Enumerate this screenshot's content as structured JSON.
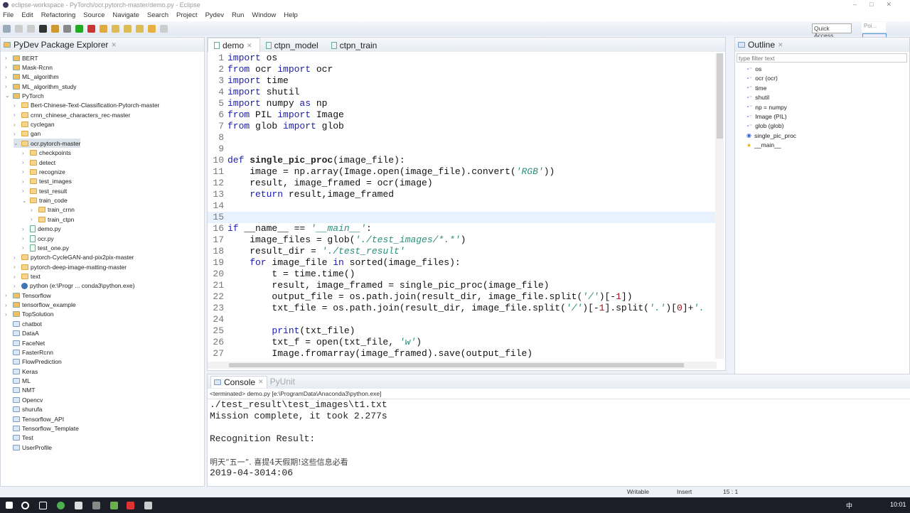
{
  "window": {
    "title": "eclipse-workspace - PyTorch/ocr.pytorch-master/demo.py - Eclipse"
  },
  "menu": [
    "File",
    "Edit",
    "Refactoring",
    "Source",
    "Navigate",
    "Search",
    "Project",
    "Pydev",
    "Run",
    "Window",
    "Help"
  ],
  "toolbar": {
    "quick_access": "Quick Access",
    "perspective": "Poi...",
    "start_label": "Start"
  },
  "explorer": {
    "title": "PyDev Package Explorer",
    "items": [
      {
        "label": "BERT",
        "depth": 0,
        "icon": "project",
        "tw": ">"
      },
      {
        "label": "Mask-Rcnn",
        "depth": 0,
        "icon": "project",
        "tw": ">"
      },
      {
        "label": "ML_algorithm",
        "depth": 0,
        "icon": "project",
        "tw": ">"
      },
      {
        "label": "ML_algorithm_study",
        "depth": 0,
        "icon": "project",
        "tw": ">"
      },
      {
        "label": "PyTorch",
        "depth": 0,
        "icon": "project",
        "tw": "v"
      },
      {
        "label": "Bert-Chinese-Text-Classification-Pytorch-master",
        "depth": 1,
        "icon": "folder",
        "tw": ">"
      },
      {
        "label": "crnn_chinese_characters_rec-master",
        "depth": 1,
        "icon": "folder",
        "tw": ">"
      },
      {
        "label": "cyclegan",
        "depth": 1,
        "icon": "folder",
        "tw": ">"
      },
      {
        "label": "gan",
        "depth": 1,
        "icon": "folder",
        "tw": ">"
      },
      {
        "label": "ocr.pytorch-master",
        "depth": 1,
        "icon": "folder",
        "tw": "v",
        "selected": true
      },
      {
        "label": "checkpoints",
        "depth": 2,
        "icon": "folder",
        "tw": ">"
      },
      {
        "label": "detect",
        "depth": 2,
        "icon": "folder",
        "tw": ">"
      },
      {
        "label": "recognize",
        "depth": 2,
        "icon": "folder",
        "tw": ">"
      },
      {
        "label": "test_images",
        "depth": 2,
        "icon": "folder",
        "tw": ">"
      },
      {
        "label": "test_result",
        "depth": 2,
        "icon": "folder",
        "tw": ">"
      },
      {
        "label": "train_code",
        "depth": 2,
        "icon": "folder",
        "tw": "v"
      },
      {
        "label": "train_crnn",
        "depth": 3,
        "icon": "folder",
        "tw": ">"
      },
      {
        "label": "train_ctpn",
        "depth": 3,
        "icon": "folder",
        "tw": ">"
      },
      {
        "label": "demo.py",
        "depth": 2,
        "icon": "file",
        "tw": ">"
      },
      {
        "label": "ocr.py",
        "depth": 2,
        "icon": "file",
        "tw": ">"
      },
      {
        "label": "test_one.py",
        "depth": 2,
        "icon": "file",
        "tw": ">"
      },
      {
        "label": "pytorch-CycleGAN-and-pix2pix-master",
        "depth": 1,
        "icon": "folder",
        "tw": ">"
      },
      {
        "label": "pytorch-deep-image-matting-master",
        "depth": 1,
        "icon": "folder",
        "tw": ">"
      },
      {
        "label": "text",
        "depth": 1,
        "icon": "folder",
        "tw": ">"
      },
      {
        "label": "python  (e:\\Progr ... conda3\\python.exe)",
        "depth": 1,
        "icon": "python",
        "tw": ">"
      },
      {
        "label": "Tensorflow",
        "depth": 0,
        "icon": "project",
        "tw": ">"
      },
      {
        "label": "tensorflow_example",
        "depth": 0,
        "icon": "project",
        "tw": ">"
      },
      {
        "label": "TopSolution",
        "depth": 0,
        "icon": "project",
        "tw": ">"
      },
      {
        "label": "chatbot",
        "depth": 0,
        "icon": "plain",
        "tw": ""
      },
      {
        "label": "DataA",
        "depth": 0,
        "icon": "plain",
        "tw": ""
      },
      {
        "label": "FaceNet",
        "depth": 0,
        "icon": "plain",
        "tw": ""
      },
      {
        "label": "FasterRcnn",
        "depth": 0,
        "icon": "plain",
        "tw": ""
      },
      {
        "label": "FlowPrediction",
        "depth": 0,
        "icon": "plain",
        "tw": ""
      },
      {
        "label": "Keras",
        "depth": 0,
        "icon": "plain",
        "tw": ""
      },
      {
        "label": "ML",
        "depth": 0,
        "icon": "plain",
        "tw": ""
      },
      {
        "label": "NMT",
        "depth": 0,
        "icon": "plain",
        "tw": ""
      },
      {
        "label": "Opencv",
        "depth": 0,
        "icon": "plain",
        "tw": ""
      },
      {
        "label": "shurufa",
        "depth": 0,
        "icon": "plain",
        "tw": ""
      },
      {
        "label": "Tensorflow_API",
        "depth": 0,
        "icon": "plain",
        "tw": ""
      },
      {
        "label": "Tensorflow_Template",
        "depth": 0,
        "icon": "plain",
        "tw": ""
      },
      {
        "label": "Test",
        "depth": 0,
        "icon": "plain",
        "tw": ""
      },
      {
        "label": "UserProfile",
        "depth": 0,
        "icon": "plain",
        "tw": ""
      }
    ]
  },
  "editor": {
    "tabs": [
      "demo",
      "ctpn_model",
      "ctpn_train"
    ],
    "active_tab": 0,
    "current_line": 15,
    "lines": [
      [
        [
          "kw",
          "import"
        ],
        [
          "tx",
          " os"
        ]
      ],
      [
        [
          "kw",
          "from"
        ],
        [
          "tx",
          " ocr "
        ],
        [
          "kw",
          "import"
        ],
        [
          "tx",
          " ocr"
        ]
      ],
      [
        [
          "kw",
          "import"
        ],
        [
          "tx",
          " time"
        ]
      ],
      [
        [
          "kw",
          "import"
        ],
        [
          "tx",
          " shutil"
        ]
      ],
      [
        [
          "kw",
          "import"
        ],
        [
          "tx",
          " numpy "
        ],
        [
          "kw",
          "as"
        ],
        [
          "tx",
          " np"
        ]
      ],
      [
        [
          "kw",
          "from"
        ],
        [
          "tx",
          " PIL "
        ],
        [
          "kw",
          "import"
        ],
        [
          "tx",
          " Image"
        ]
      ],
      [
        [
          "kw",
          "from"
        ],
        [
          "tx",
          " glob "
        ],
        [
          "kw",
          "import"
        ],
        [
          "tx",
          " glob"
        ]
      ],
      [],
      [],
      [
        [
          "kw",
          "def"
        ],
        [
          "tx",
          " "
        ],
        [
          "fn",
          "single_pic_proc"
        ],
        [
          "tx",
          "(image_file):"
        ]
      ],
      [
        [
          "tx",
          "    image = np.array(Image.open(image_file).convert("
        ],
        [
          "str",
          "'RGB'"
        ],
        [
          "tx",
          "))"
        ]
      ],
      [
        [
          "tx",
          "    result, image_framed = ocr(image)"
        ]
      ],
      [
        [
          "kw",
          "    return"
        ],
        [
          "tx",
          " result,image_framed"
        ]
      ],
      [],
      [],
      [
        [
          "kw",
          "if"
        ],
        [
          "tx",
          " __name__ == "
        ],
        [
          "str",
          "'__main__'"
        ],
        [
          "tx",
          ":"
        ]
      ],
      [
        [
          "tx",
          "    image_files = glob("
        ],
        [
          "str",
          "'./test_images/*.*'"
        ],
        [
          "tx",
          ")"
        ]
      ],
      [
        [
          "tx",
          "    result_dir = "
        ],
        [
          "str",
          "'./test_result'"
        ]
      ],
      [
        [
          "kw",
          "    for"
        ],
        [
          "tx",
          " image_file "
        ],
        [
          "kw",
          "in"
        ],
        [
          "tx",
          " sorted(image_files):"
        ]
      ],
      [
        [
          "tx",
          "        t = time.time()"
        ]
      ],
      [
        [
          "tx",
          "        result, image_framed = single_pic_proc(image_file)"
        ]
      ],
      [
        [
          "tx",
          "        output_file = os.path.join(result_dir, image_file.split("
        ],
        [
          "str",
          "'/'"
        ],
        [
          "tx",
          ")[-"
        ],
        [
          "num",
          "1"
        ],
        [
          "tx",
          "])"
        ]
      ],
      [
        [
          "tx",
          "        txt_file = os.path.join(result_dir, image_file.split("
        ],
        [
          "str",
          "'/'"
        ],
        [
          "tx",
          ")[-"
        ],
        [
          "num",
          "1"
        ],
        [
          "tx",
          "].split("
        ],
        [
          "str",
          "'.'"
        ],
        [
          "tx",
          ")["
        ],
        [
          "num",
          "0"
        ],
        [
          "tx",
          "]+"
        ],
        [
          "str",
          "'."
        ]
      ],
      [],
      [
        [
          "kw",
          "        print"
        ],
        [
          "tx",
          "(txt_file)"
        ]
      ],
      [
        [
          "tx",
          "        txt_f = open(txt_file, "
        ],
        [
          "str",
          "'w'"
        ],
        [
          "tx",
          ")"
        ]
      ],
      [
        [
          "tx",
          "        Image.fromarray(image_framed).save(output_file)"
        ]
      ]
    ]
  },
  "outline": {
    "title": "Outline",
    "filter_placeholder": "type filter text",
    "items": [
      {
        "label": "os",
        "kind": "import"
      },
      {
        "label": "ocr (ocr)",
        "kind": "import"
      },
      {
        "label": "time",
        "kind": "import"
      },
      {
        "label": "shutil",
        "kind": "import"
      },
      {
        "label": "np = numpy",
        "kind": "import"
      },
      {
        "label": "Image (PIL)",
        "kind": "import"
      },
      {
        "label": "glob (glob)",
        "kind": "import"
      },
      {
        "label": "single_pic_proc",
        "kind": "function"
      },
      {
        "label": "__main__",
        "kind": "main"
      }
    ]
  },
  "console": {
    "tabs": [
      "Console",
      "PyUnit"
    ],
    "status": "<terminated> demo.py [e:\\ProgramData\\Anaconda3\\python.exe]",
    "lines": [
      "./test_result\\test_images\\t1.txt",
      "Mission complete, it took 2.277s",
      "",
      "Recognition Result:",
      "",
      "明天“五一”. 喜提4天假期!这些信息必看",
      "2019-04-3014:06"
    ]
  },
  "statusbar": {
    "writable": "Writable",
    "insert": "Insert",
    "position": "15 : 1"
  },
  "taskbar": {
    "time": "10:01",
    "ime": "中"
  }
}
